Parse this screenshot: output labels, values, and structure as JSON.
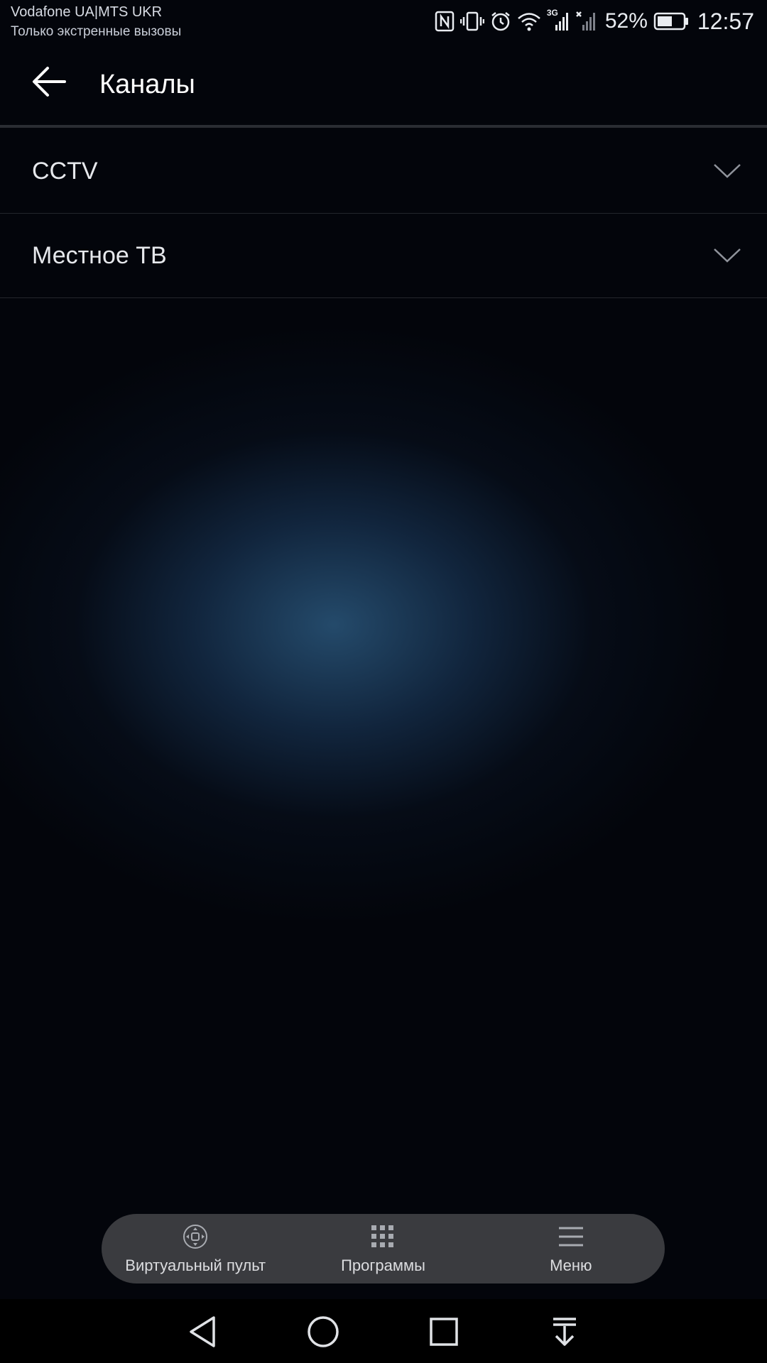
{
  "status_bar": {
    "carrier": "Vodafone UA|MTS UKR",
    "emergency": "Только экстренные вызовы",
    "network_type": "3G",
    "battery": "52%",
    "time": "12:57",
    "icons": [
      "nfc-icon",
      "vibrate-icon",
      "alarm-icon",
      "wifi-icon",
      "signal-icon",
      "signal-no-service-icon",
      "battery-icon"
    ]
  },
  "app_bar": {
    "title": "Каналы",
    "back_icon": "arrow-left-icon"
  },
  "channel_groups": [
    {
      "label": "CCTV",
      "icon": "chevron-down-icon"
    },
    {
      "label": "Местное ТВ",
      "icon": "chevron-down-icon"
    }
  ],
  "bottom_bar": {
    "items": [
      {
        "label": "Виртуальный пульт",
        "icon": "remote-dpad-icon"
      },
      {
        "label": "Программы",
        "icon": "apps-grid-icon"
      },
      {
        "label": "Меню",
        "icon": "menu-icon"
      }
    ],
    "background": "#3a3b3f"
  },
  "nav_bar": {
    "icons": [
      "back-triangle-icon",
      "home-circle-icon",
      "recents-square-icon",
      "notification-pull-icon"
    ]
  },
  "colors": {
    "background": "#03050b",
    "glow": "#264e70",
    "text": "#ffffff",
    "divider": "#23262c"
  }
}
